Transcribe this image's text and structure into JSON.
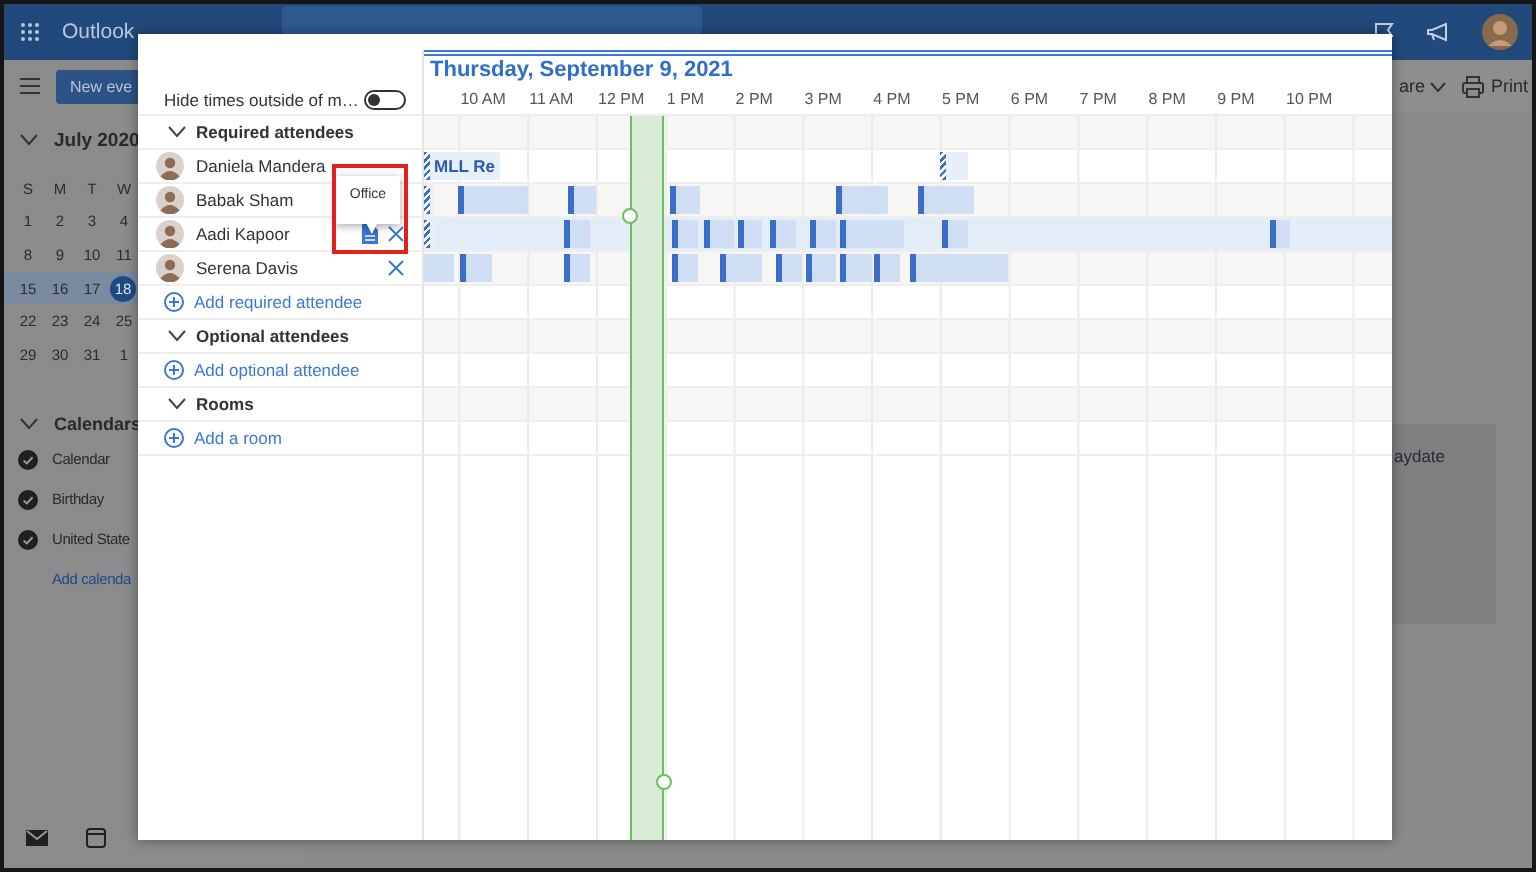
{
  "app": {
    "name": "Outlook",
    "new_button": "New eve",
    "month": "July 2020",
    "month_expanded": true,
    "weekdays": [
      "S",
      "M",
      "T",
      "W"
    ],
    "weeks": [
      {
        "selected": false,
        "days": [
          {
            "label": "1",
            "today": false
          },
          {
            "label": "2",
            "today": false
          },
          {
            "label": "3",
            "today": false
          },
          {
            "label": "4",
            "today": false
          }
        ]
      },
      {
        "selected": false,
        "days": [
          {
            "label": "8",
            "today": false
          },
          {
            "label": "9",
            "today": false
          },
          {
            "label": "10",
            "today": false
          },
          {
            "label": "11",
            "today": false
          }
        ]
      },
      {
        "selected": true,
        "days": [
          {
            "label": "15",
            "today": false
          },
          {
            "label": "16",
            "today": false
          },
          {
            "label": "17",
            "today": false
          },
          {
            "label": "18",
            "today": true
          }
        ]
      },
      {
        "selected": false,
        "days": [
          {
            "label": "22",
            "today": false
          },
          {
            "label": "23",
            "today": false
          },
          {
            "label": "24",
            "today": false
          },
          {
            "label": "25",
            "today": false
          }
        ]
      },
      {
        "selected": false,
        "days": [
          {
            "label": "29",
            "today": false
          },
          {
            "label": "30",
            "today": false
          },
          {
            "label": "31",
            "today": false
          },
          {
            "label": "1",
            "today": false
          }
        ]
      }
    ],
    "calendars": {
      "title": "Calendars",
      "expanded": true,
      "items": [
        {
          "label": "Calendar",
          "checked": true
        },
        {
          "label": "Birthday",
          "checked": true
        },
        {
          "label": "United State",
          "checked": true
        }
      ],
      "add_link": "Add calenda"
    },
    "toolbar": {
      "share_label": "are",
      "print_label": "Print"
    },
    "card_title": "aydate"
  },
  "scheduler": {
    "date": "Thursday, September 9, 2021",
    "hide_toggle": {
      "label": "Hide times outside of m…",
      "on": false
    },
    "hours": [
      "10 AM",
      "11 AM",
      "12 PM",
      "1 PM",
      "2 PM",
      "3 PM",
      "4 PM",
      "5 PM",
      "6 PM",
      "7 PM",
      "8 PM",
      "9 PM",
      "10 PM"
    ],
    "rows": [
      {
        "kind": "section",
        "label": "Required attendees",
        "expanded": true
      },
      {
        "kind": "attendee",
        "name": "Daniela Mandera",
        "selected": false,
        "removable": false,
        "events": [
          {
            "kind": "tentative",
            "title": "MLL Re"
          },
          {
            "kind": "tentative"
          }
        ]
      },
      {
        "kind": "attendee",
        "name": "Babak Sham",
        "selected": false,
        "removable": false,
        "events": [
          {
            "kind": "tentative"
          },
          {
            "kind": "busy"
          },
          {
            "kind": "busy"
          },
          {
            "kind": "busy"
          },
          {
            "kind": "busy"
          },
          {
            "kind": "busy"
          }
        ]
      },
      {
        "kind": "attendee",
        "name": "Aadi Kapoor",
        "selected": true,
        "removable": true,
        "location": {
          "tooltip": "Office"
        },
        "events": [
          {
            "kind": "tentative"
          },
          {
            "kind": "busy"
          },
          {
            "kind": "busy"
          },
          {
            "kind": "busy"
          },
          {
            "kind": "busy"
          },
          {
            "kind": "busy"
          },
          {
            "kind": "busy"
          },
          {
            "kind": "busy"
          },
          {
            "kind": "busy"
          },
          {
            "kind": "busy"
          }
        ]
      },
      {
        "kind": "attendee",
        "name": "Serena Davis",
        "selected": false,
        "removable": true,
        "events": [
          {
            "kind": "busy"
          },
          {
            "kind": "busy"
          },
          {
            "kind": "busy"
          },
          {
            "kind": "busy"
          },
          {
            "kind": "busy"
          },
          {
            "kind": "busy"
          },
          {
            "kind": "busy"
          },
          {
            "kind": "busy"
          },
          {
            "kind": "busy"
          },
          {
            "kind": "busy"
          }
        ]
      },
      {
        "kind": "add",
        "label": "Add required attendee"
      },
      {
        "kind": "section",
        "label": "Optional attendees",
        "expanded": true
      },
      {
        "kind": "add",
        "label": "Add optional attendee"
      },
      {
        "kind": "section",
        "label": "Rooms",
        "expanded": true
      },
      {
        "kind": "add",
        "label": "Add a room"
      }
    ]
  }
}
